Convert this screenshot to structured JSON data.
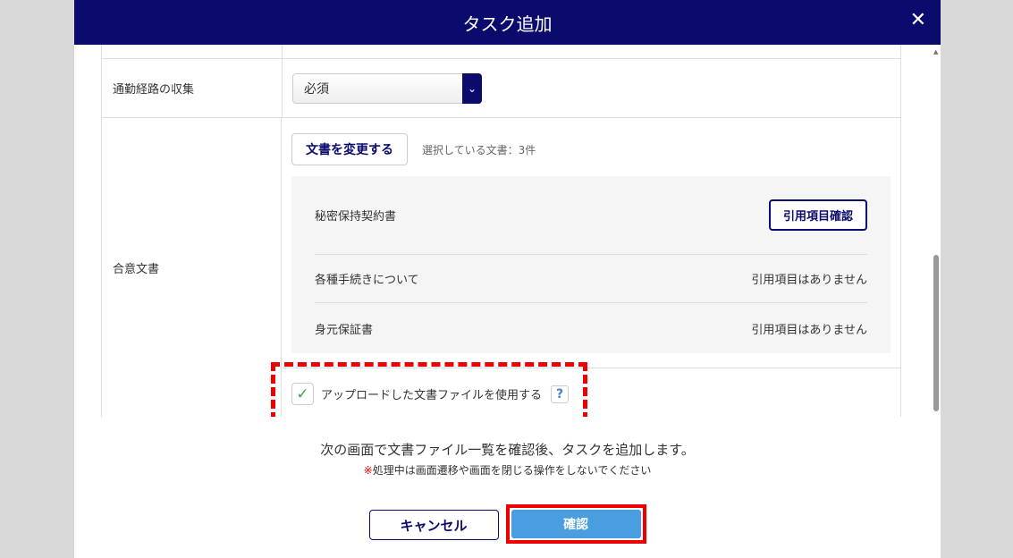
{
  "dialog": {
    "title": "タスク追加",
    "close_icon": "close-icon"
  },
  "rows": {
    "commute": {
      "label": "通勤経路の収集",
      "select_value": "必須"
    },
    "agreement": {
      "label": "合意文書",
      "change_button": "文書を変更する",
      "selected_count": "選択している文書：3件",
      "documents": [
        {
          "name": "秘密保持契約書",
          "action": "引用項目確認"
        },
        {
          "name": "各種手続きについて",
          "status": "引用項目はありません"
        },
        {
          "name": "身元保証書",
          "status": "引用項目はありません"
        }
      ],
      "checkbox_label": "アップロードした文書ファイルを使用する",
      "checkbox_checked": true,
      "help": "?"
    }
  },
  "footer": {
    "message": "次の画面で文書ファイル一覧を確認後、タスクを追加します。",
    "warning_mark": "※",
    "warning": "処理中は画面遷移や画面を閉じる操作をしないでください",
    "cancel": "キャンセル",
    "confirm": "確認"
  },
  "colors": {
    "navy": "#0b0b6e",
    "accent_blue": "#4a9ee0",
    "highlight_red": "#e00000"
  }
}
